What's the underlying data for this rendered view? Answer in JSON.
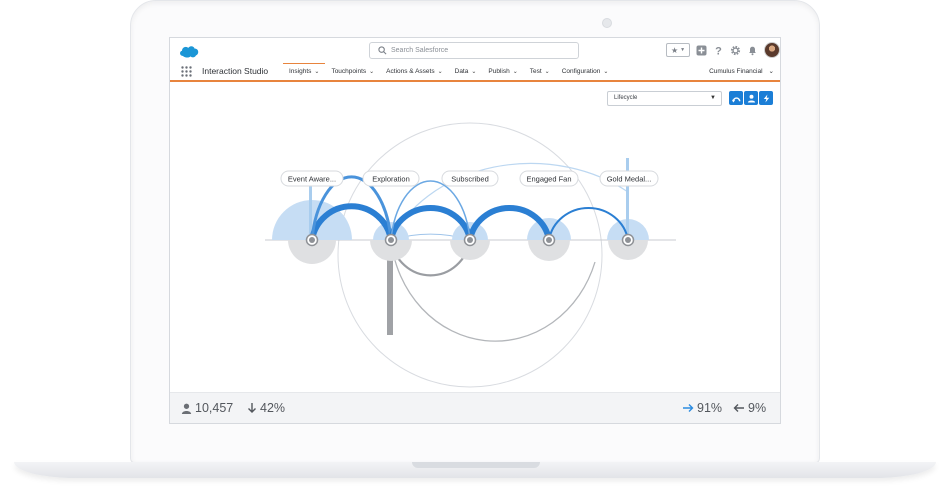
{
  "app": {
    "search_placeholder": "Search Salesforce",
    "app_name": "Interaction Studio",
    "account": "Cumulus Financial"
  },
  "nav": [
    {
      "label": "Insights",
      "active": true
    },
    {
      "label": "Touchpoints"
    },
    {
      "label": "Actions & Assets"
    },
    {
      "label": "Data"
    },
    {
      "label": "Publish"
    },
    {
      "label": "Test"
    },
    {
      "label": "Configuration"
    }
  ],
  "toolbar": {
    "selected_view": "Lifecycle"
  },
  "stages": [
    {
      "label": "Event Aware..."
    },
    {
      "label": "Exploration"
    },
    {
      "label": "Subscribed"
    },
    {
      "label": "Engaged Fan"
    },
    {
      "label": "Gold Medal..."
    }
  ],
  "footer": {
    "users": "10,457",
    "drop": "42%",
    "forward": "91%",
    "back": "9%"
  },
  "colors": {
    "brand": "#1b7ed6",
    "accent": "#e8843d",
    "flow_light": "#b9d6f2"
  }
}
